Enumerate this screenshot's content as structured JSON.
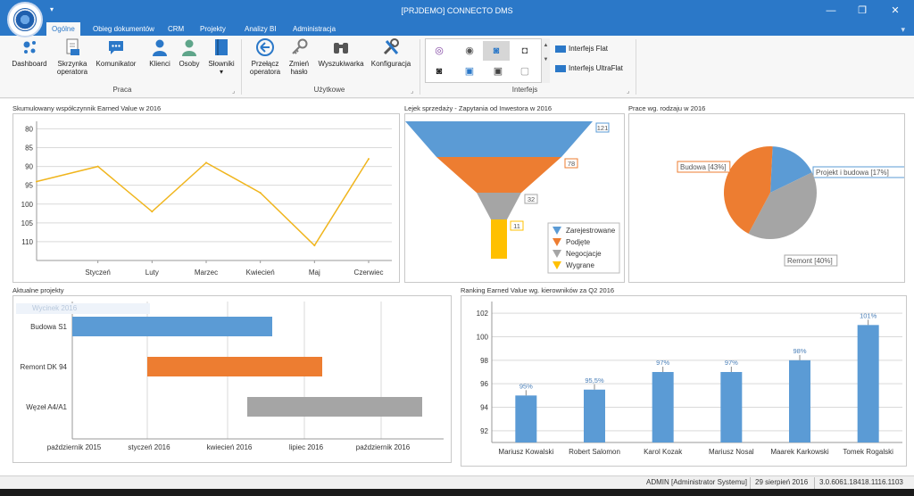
{
  "window": {
    "title": "[PRJDEMO] CONNECTO DMS",
    "qat": "▾",
    "minimize": "—",
    "restore": "❐",
    "close": "✕"
  },
  "ribbon": {
    "tabs": [
      {
        "label": "Ogólne",
        "active": true
      },
      {
        "label": "Obieg dokumentów",
        "active": false
      },
      {
        "label": "CRM",
        "active": false
      },
      {
        "label": "Projekty",
        "active": false
      },
      {
        "label": "Analizy BI",
        "active": false
      },
      {
        "label": "Administracja",
        "active": false
      }
    ],
    "options_icon": "▾",
    "groups": {
      "praca": {
        "label": "Praca",
        "buttons": [
          "Dashboard",
          "Skrzynka operatora",
          "Komunikator",
          "Klienci",
          "Osoby",
          "Słowniki"
        ]
      },
      "uzytkowe": {
        "label": "Użytkowe",
        "buttons": [
          "Przełącz operatora",
          "Zmień hasło",
          "Wyszukiwarka",
          "Konfiguracja"
        ]
      },
      "interfejs": {
        "label": "Interfejs",
        "buttons": [
          "Interfejs Flat",
          "Interfejs UltraFlat"
        ]
      }
    },
    "launcher_glyph": "⌟",
    "dropdown_glyph": "▾"
  },
  "dashboard": {
    "line_panel_title": "Skumulowany współczynnik Earned Value w 2016",
    "funnel_panel_title": "Lejek sprzedaży - Zapytania od Inwestora w 2016",
    "pie_panel_title": "Prace wg. rodzaju w 2016",
    "gantt_panel_title": "Aktualne projekty",
    "bar_panel_title": "Ranking Earned Value wg. kierowników za Q2 2016",
    "gantt_overlay_hint": "Wycinek 2016"
  },
  "chart_data": [
    {
      "type": "line",
      "categories": [
        "Styczeń",
        "Luty",
        "Marzec",
        "Kwiecień",
        "Maj",
        "Czerwiec"
      ],
      "y_inverted": true,
      "ylim": [
        78,
        115
      ],
      "yticks": [
        80,
        85,
        90,
        95,
        100,
        105,
        110
      ],
      "series": [
        {
          "values": [
            94,
            90,
            102,
            89,
            97,
            111,
            88
          ]
        }
      ],
      "x_points": [
        "start",
        "Styczeń",
        "Luty",
        "Marzec",
        "Kwiecień",
        "Maj",
        "Czerwiec"
      ],
      "grid": true,
      "color": "#f0b51d"
    },
    {
      "type": "funnel",
      "categories": [
        "Zarejestrowane",
        "Podjęte",
        "Negocjacje",
        "Wygrane"
      ],
      "values": [
        121,
        78,
        32,
        11
      ],
      "colors": [
        "#5b9bd5",
        "#ed7d31",
        "#a5a5a5",
        "#ffc000"
      ],
      "legend": "bottom-right"
    },
    {
      "type": "pie",
      "categories": [
        "Projekt i budowa",
        "Remont",
        "Budowa"
      ],
      "values": [
        17,
        40,
        43
      ],
      "labels": [
        "Projekt i budowa [17%]",
        "Remont [40%]",
        "Budowa [43%]"
      ],
      "colors": [
        "#5b9bd5",
        "#a5a5a5",
        "#ed7d31"
      ]
    },
    {
      "type": "gantt",
      "categories": [
        "Budowa S1",
        "Remont DK 94",
        "Węzeł A4/A1"
      ],
      "xticks": [
        "październik 2015",
        "styczeń 2016",
        "kwiecień 2016",
        "lipiec 2016",
        "październik 2016"
      ],
      "xlim": [
        "2015-10",
        "2016-11"
      ],
      "tasks": [
        {
          "name": "Budowa S1",
          "start": "2015-10",
          "end": "2016-06",
          "color": "#5b9bd5"
        },
        {
          "name": "Remont DK 94",
          "start": "2016-01",
          "end": "2016-08",
          "color": "#ed7d31"
        },
        {
          "name": "Węzeł A4/A1",
          "start": "2016-05",
          "end": "2016-12",
          "color": "#a5a5a5"
        }
      ]
    },
    {
      "type": "bar",
      "categories": [
        "Mariusz Kowalski",
        "Robert Salomon",
        "Karol Kozak",
        "Mariusz Nosal",
        "Maarek Karkowski",
        "Tomek Rogalski"
      ],
      "values": [
        95,
        95.5,
        97,
        97,
        98,
        101
      ],
      "data_labels": [
        "95%",
        "95,5%",
        "97%",
        "97%",
        "98%",
        "101%"
      ],
      "ylim": [
        91,
        103
      ],
      "yticks": [
        92,
        94,
        96,
        98,
        100,
        102
      ],
      "color": "#5b9bd5"
    }
  ],
  "status": {
    "user": "ADMIN [Administrator Systemu]",
    "date": "29 sierpień 2016",
    "version": "3.0.6061.18418.1116.1103"
  }
}
